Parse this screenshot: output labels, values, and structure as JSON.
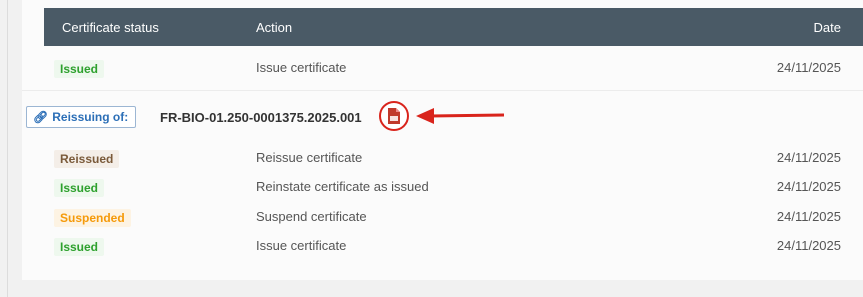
{
  "table": {
    "headers": {
      "status": "Certificate status",
      "action": "Action",
      "date": "Date"
    }
  },
  "top_rows": [
    {
      "status": "Issued",
      "status_kind": "issued",
      "action": "Issue certificate",
      "date": "24/11/2025"
    }
  ],
  "reissue": {
    "label": "Reissuing of:",
    "certificate_ref": "FR-BIO-01.250-0001375.2025.001"
  },
  "history_rows": [
    {
      "status": "Reissued",
      "status_kind": "reissued",
      "action": "Reissue certificate",
      "date": "24/11/2025"
    },
    {
      "status": "Issued",
      "status_kind": "issued",
      "action": "Reinstate certificate as issued",
      "date": "24/11/2025"
    },
    {
      "status": "Suspended",
      "status_kind": "suspended",
      "action": "Suspend certificate",
      "date": "24/11/2025"
    },
    {
      "status": "Issued",
      "status_kind": "issued",
      "action": "Issue certificate",
      "date": "24/11/2025"
    }
  ],
  "colors": {
    "header_bg": "#4a5a66",
    "issued": "#2ea12e",
    "suspended": "#f59a0a",
    "reissued": "#7a5a3a",
    "annotation": "#d9241c"
  },
  "icons": {
    "link": "link-icon",
    "pdf": "pdf-file-icon",
    "arrow": "arrow-left-icon"
  }
}
